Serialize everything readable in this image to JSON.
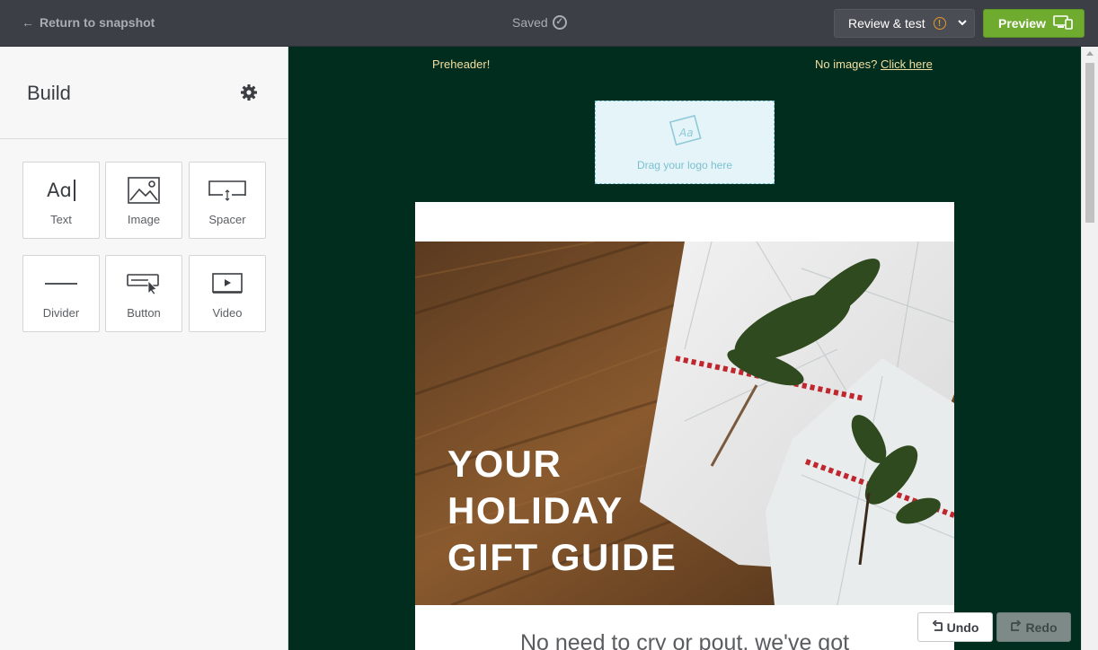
{
  "topbar": {
    "back_label": "Return to snapshot",
    "status": "Saved",
    "review_label": "Review & test",
    "preview_label": "Preview"
  },
  "sidebar": {
    "title": "Build",
    "tiles": [
      {
        "label": "Text",
        "icon": "text-icon"
      },
      {
        "label": "Image",
        "icon": "image-icon"
      },
      {
        "label": "Spacer",
        "icon": "spacer-icon"
      },
      {
        "label": "Divider",
        "icon": "divider-icon"
      },
      {
        "label": "Button",
        "icon": "button-icon"
      },
      {
        "label": "Video",
        "icon": "video-icon"
      }
    ],
    "text_icon_glyph": "Aɑ"
  },
  "email": {
    "preheader": "Preheader!",
    "no_images_text": "No images?",
    "no_images_link": "Click here",
    "logo_placeholder": "Drag your logo here",
    "hero_line1": "YOUR",
    "hero_line2": "HOLIDAY",
    "hero_line3": "GIFT GUIDE",
    "body_text": "No need to cry or pout, we've got"
  },
  "history": {
    "undo_label": "Undo",
    "redo_label": "Redo"
  },
  "colors": {
    "topbar_bg": "#3c4046",
    "canvas_bg": "#002d1e",
    "preview_green": "#6eab2e",
    "preheader_text": "#f4dfa0",
    "warning_orange": "#e8962a"
  }
}
